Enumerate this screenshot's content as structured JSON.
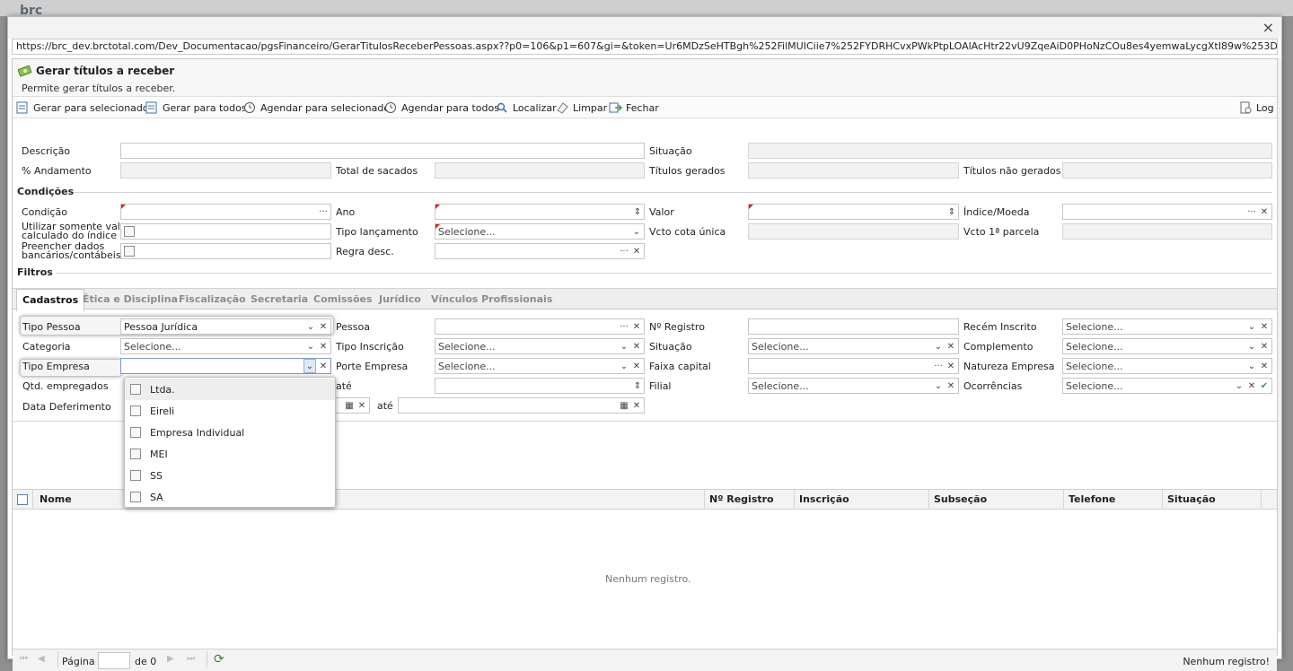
{
  "backdrop": {
    "logo": "brc"
  },
  "window": {
    "close_label": "×",
    "url": "https://brc_dev.brctotal.com/Dev_Documentacao/pgsFinanceiro/GerarTitulosReceberPessoas.aspx??p0=106&p1=607&gi=&token=Ur6MDzSeHTBgh%252FilMUICiie7%252FYDRHCvxPWkPtpLOAlAcHtr22vU9ZqeAiD0PHoNzCOu8es4yemwaLycgXtI89w%253D%253D&ownerResizeID=q-comp-"
  },
  "page": {
    "title": "Gerar títulos a receber",
    "subtitle": "Permite gerar títulos a receber."
  },
  "toolbar": {
    "gerar_selecionados": "Gerar para selecionados",
    "gerar_todos": "Gerar para todos",
    "agendar_selecionados": "Agendar para selecionados",
    "agendar_todos": "Agendar para todos",
    "localizar": "Localizar",
    "limpar": "Limpar",
    "fechar": "Fechar",
    "log": "Log"
  },
  "form": {
    "descricao": "Descrição",
    "situacao": "Situação",
    "andamento": "% Andamento",
    "total_sacados": "Total de sacados",
    "titulos_gerados": "Títulos gerados",
    "titulos_nao_gerados": "Títulos não gerados"
  },
  "condicoes": {
    "title": "Condições",
    "condicao": "Condição",
    "ano": "Ano",
    "valor": "Valor",
    "indice_moeda": "Índice/Moeda",
    "utilizar_line1": "Utilizar somente valor",
    "utilizar_line2": "calculado do índice",
    "tipo_lancamento": "Tipo lançamento",
    "tipo_lancamento_value": "Selecione...",
    "vcto_cota_unica": "Vcto cota única",
    "vcto_1_parcela": "Vcto 1ª parcela",
    "preencher_line1": "Preencher dados",
    "preencher_line2": "bancários/contábeis",
    "regra_desc": "Regra desc."
  },
  "filtros": {
    "title": "Filtros",
    "tabs": [
      "Cadastros",
      "Ética e Disciplina",
      "Fiscalização",
      "Secretaria",
      "Comissões",
      "Jurídico",
      "Vínculos Profissionais"
    ],
    "tipo_pessoa": "Tipo Pessoa",
    "tipo_pessoa_value": "Pessoa Jurídica",
    "pessoa": "Pessoa",
    "n_registro": "Nº Registro",
    "recem_inscrito": "Recém Inscrito",
    "recem_inscrito_value": "Selecione...",
    "categoria": "Categoria",
    "categoria_value": "Selecione...",
    "tipo_inscricao": "Tipo Inscrição",
    "tipo_inscricao_value": "Selecione...",
    "situacao": "Situação",
    "situacao_value": "Selecione...",
    "complemento": "Complemento",
    "complemento_value": "Selecione...",
    "tipo_empresa": "Tipo Empresa",
    "porte_empresa": "Porte Empresa",
    "porte_empresa_value": "Selecione...",
    "faixa_capital": "Faixa capital",
    "natureza_empresa": "Natureza Empresa",
    "natureza_empresa_value": "Selecione...",
    "qtd_empregados": "Qtd. empregados",
    "ate": "até",
    "filial": "Filial",
    "filial_value": "Selecione...",
    "ocorrencias": "Ocorrências",
    "ocorrencias_value": "Selecione...",
    "data_deferimento": "Data Deferimento",
    "ate2": "até"
  },
  "tipo_empresa_options": [
    "Ltda.",
    "Eireli",
    "Empresa Individual",
    "MEI",
    "SS",
    "SA"
  ],
  "grid": {
    "columns": [
      "Nome",
      "Nº Registro",
      "Inscrição",
      "Subseção",
      "Telefone",
      "Situação"
    ],
    "empty": "Nenhum registro."
  },
  "pager": {
    "pagina": "Página",
    "de": "de 0",
    "status": "Nenhum registro!"
  }
}
